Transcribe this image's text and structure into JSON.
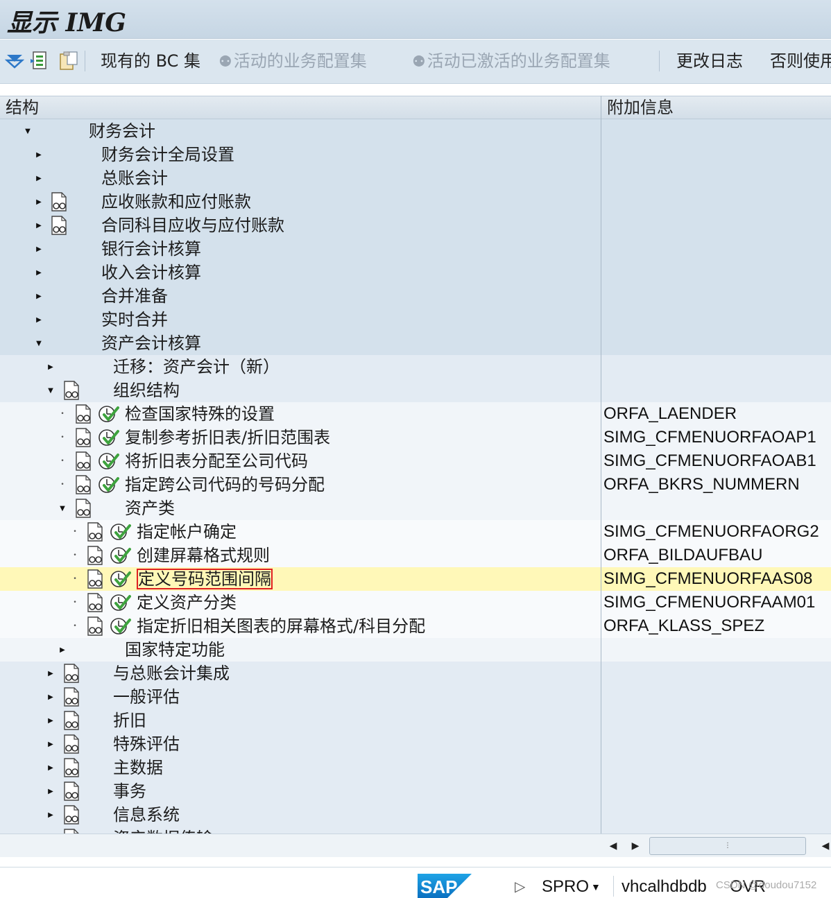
{
  "window": {
    "title": "显示 IMG"
  },
  "toolbar": {
    "bc_sets_label": "现有的 BC 集",
    "active_bc_sets_label": "活动的业务配置集",
    "activated_bc_sets_label": "活动已激活的业务配置集",
    "change_log_label": "更改日志",
    "otherwise_label": "否则使用"
  },
  "header": {
    "structure": "结构",
    "additional_info": "附加信息"
  },
  "tree": [
    {
      "label": "财务会计",
      "info": "",
      "level": 0,
      "expander": "open",
      "doc": false,
      "activity": false
    },
    {
      "label": "财务会计全局设置",
      "info": "",
      "level": 1,
      "expander": "closed",
      "doc": false,
      "activity": false
    },
    {
      "label": "总账会计",
      "info": "",
      "level": 1,
      "expander": "closed",
      "doc": false,
      "activity": false
    },
    {
      "label": "应收账款和应付账款",
      "info": "",
      "level": 1,
      "expander": "closed",
      "doc": true,
      "activity": false
    },
    {
      "label": "合同科目应收与应付账款",
      "info": "",
      "level": 1,
      "expander": "closed",
      "doc": true,
      "activity": false
    },
    {
      "label": "银行会计核算",
      "info": "",
      "level": 1,
      "expander": "closed",
      "doc": false,
      "activity": false
    },
    {
      "label": "收入会计核算",
      "info": "",
      "level": 1,
      "expander": "closed",
      "doc": false,
      "activity": false
    },
    {
      "label": "合并准备",
      "info": "",
      "level": 1,
      "expander": "closed",
      "doc": false,
      "activity": false
    },
    {
      "label": "实时合并",
      "info": "",
      "level": 1,
      "expander": "closed",
      "doc": false,
      "activity": false
    },
    {
      "label": "资产会计核算",
      "info": "",
      "level": 1,
      "expander": "open",
      "doc": false,
      "activity": false
    },
    {
      "label": "迁移：资产会计（新）",
      "info": "",
      "level": 2,
      "expander": "closed",
      "doc": false,
      "activity": false
    },
    {
      "label": "组织结构",
      "info": "",
      "level": 2,
      "expander": "open",
      "doc": true,
      "activity": false
    },
    {
      "label": "检查国家特殊的设置",
      "info": "ORFA_LAENDER",
      "level": 3,
      "expander": "leaf",
      "doc": true,
      "activity": true
    },
    {
      "label": "复制参考折旧表/折旧范围表",
      "info": "SIMG_CFMENUORFAOAP1",
      "level": 3,
      "expander": "leaf",
      "doc": true,
      "activity": true
    },
    {
      "label": "将折旧表分配至公司代码",
      "info": "SIMG_CFMENUORFAOAB1",
      "level": 3,
      "expander": "leaf",
      "doc": true,
      "activity": true
    },
    {
      "label": "指定跨公司代码的号码分配",
      "info": "ORFA_BKRS_NUMMERN",
      "level": 3,
      "expander": "leaf",
      "doc": true,
      "activity": true
    },
    {
      "label": "资产类",
      "info": "",
      "level": 3,
      "expander": "open",
      "doc": true,
      "activity": false
    },
    {
      "label": "指定帐户确定",
      "info": "SIMG_CFMENUORFAORG2",
      "level": 4,
      "expander": "leaf",
      "doc": true,
      "activity": true
    },
    {
      "label": "创建屏幕格式规则",
      "info": "ORFA_BILDAUFBAU",
      "level": 4,
      "expander": "leaf",
      "doc": true,
      "activity": true
    },
    {
      "label": "定义号码范围间隔",
      "info": "SIMG_CFMENUORFAAS08",
      "level": 4,
      "expander": "leaf",
      "doc": true,
      "activity": true,
      "selected": true
    },
    {
      "label": "定义资产分类",
      "info": "SIMG_CFMENUORFAAM01",
      "level": 4,
      "expander": "leaf",
      "doc": true,
      "activity": true
    },
    {
      "label": "指定折旧相关图表的屏幕格式/科目分配",
      "info": "ORFA_KLASS_SPEZ",
      "level": 4,
      "expander": "leaf",
      "doc": true,
      "activity": true
    },
    {
      "label": "国家特定功能",
      "info": "",
      "level": 3,
      "expander": "closed",
      "doc": false,
      "activity": false
    },
    {
      "label": "与总账会计集成",
      "info": "",
      "level": 2,
      "expander": "closed",
      "doc": true,
      "activity": false
    },
    {
      "label": "一般评估",
      "info": "",
      "level": 2,
      "expander": "closed",
      "doc": true,
      "activity": false
    },
    {
      "label": "折旧",
      "info": "",
      "level": 2,
      "expander": "closed",
      "doc": true,
      "activity": false
    },
    {
      "label": "特殊评估",
      "info": "",
      "level": 2,
      "expander": "closed",
      "doc": true,
      "activity": false
    },
    {
      "label": "主数据",
      "info": "",
      "level": 2,
      "expander": "closed",
      "doc": true,
      "activity": false
    },
    {
      "label": "事务",
      "info": "",
      "level": 2,
      "expander": "closed",
      "doc": true,
      "activity": false
    },
    {
      "label": "信息系统",
      "info": "",
      "level": 2,
      "expander": "closed",
      "doc": true,
      "activity": false
    },
    {
      "label": "资产数据传输",
      "info": "",
      "level": 2,
      "expander": "closed",
      "doc": true,
      "activity": false
    }
  ],
  "statusbar": {
    "logo_text": "SAP",
    "transaction": "SPRO",
    "host": "vhcalhdbdb",
    "mode": "OVR",
    "watermark": "CSDN @doudou7152"
  },
  "colors": {
    "title_band": "#c6d6e4",
    "level0_band": "#d4e1ec",
    "selected_row": "#fff8b8",
    "selection_box": "#e02020",
    "activity_check": "#3ea33e"
  }
}
